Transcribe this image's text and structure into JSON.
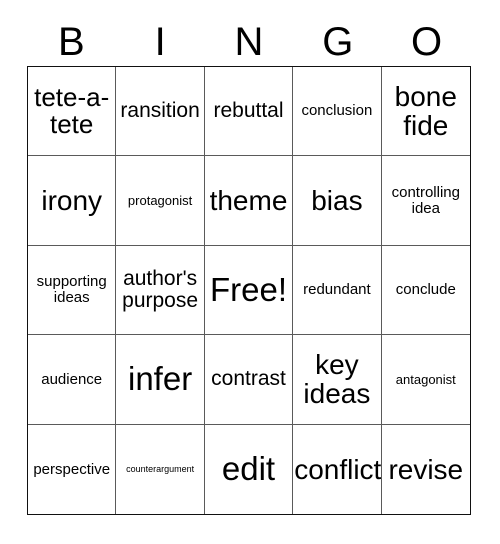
{
  "card": {
    "title": "BINGO",
    "header_letters": [
      "B",
      "I",
      "N",
      "G",
      "O"
    ],
    "free_space_label": "Free!",
    "colors": {
      "background": "#ffffff",
      "text": "#000000",
      "outer_border": "#111111",
      "inner_border": "#5a5a5a"
    },
    "grid": {
      "rows": 5,
      "columns": 5,
      "cells": [
        [
          {
            "text": "tete-a-tete",
            "size": "lg",
            "clip": false
          },
          {
            "text": "ransition",
            "size": "md",
            "clip": true
          },
          {
            "text": "rebuttal",
            "size": "md",
            "clip": false
          },
          {
            "text": "conclusion",
            "size": "sm",
            "clip": false
          },
          {
            "text": "bone fide",
            "size": "xl",
            "clip": false
          }
        ],
        [
          {
            "text": "irony",
            "size": "xl",
            "clip": false
          },
          {
            "text": "protagonist",
            "size": "xs",
            "clip": false
          },
          {
            "text": "theme",
            "size": "xl",
            "clip": false
          },
          {
            "text": "bias",
            "size": "xl",
            "clip": false
          },
          {
            "text": "controlling idea",
            "size": "sm",
            "clip": false
          }
        ],
        [
          {
            "text": "supporting ideas",
            "size": "sm",
            "clip": false
          },
          {
            "text": "author's purpose",
            "size": "md",
            "clip": false
          },
          {
            "text": "Free!",
            "size": "xxl",
            "clip": true
          },
          {
            "text": "redundant",
            "size": "sm",
            "clip": false
          },
          {
            "text": "conclude",
            "size": "sm",
            "clip": false
          }
        ],
        [
          {
            "text": "audience",
            "size": "sm",
            "clip": false
          },
          {
            "text": "infer",
            "size": "xxl",
            "clip": false
          },
          {
            "text": "contrast",
            "size": "md",
            "clip": false
          },
          {
            "text": "key ideas",
            "size": "xl",
            "clip": false
          },
          {
            "text": "antagonist",
            "size": "xs",
            "clip": false
          }
        ],
        [
          {
            "text": "perspective",
            "size": "sm",
            "clip": false
          },
          {
            "text": "counterargument",
            "size": "xxs",
            "clip": false
          },
          {
            "text": "edit",
            "size": "xxl",
            "clip": false
          },
          {
            "text": "conflict",
            "size": "xl",
            "clip": false
          },
          {
            "text": "revise",
            "size": "xl",
            "clip": false
          }
        ]
      ]
    }
  }
}
